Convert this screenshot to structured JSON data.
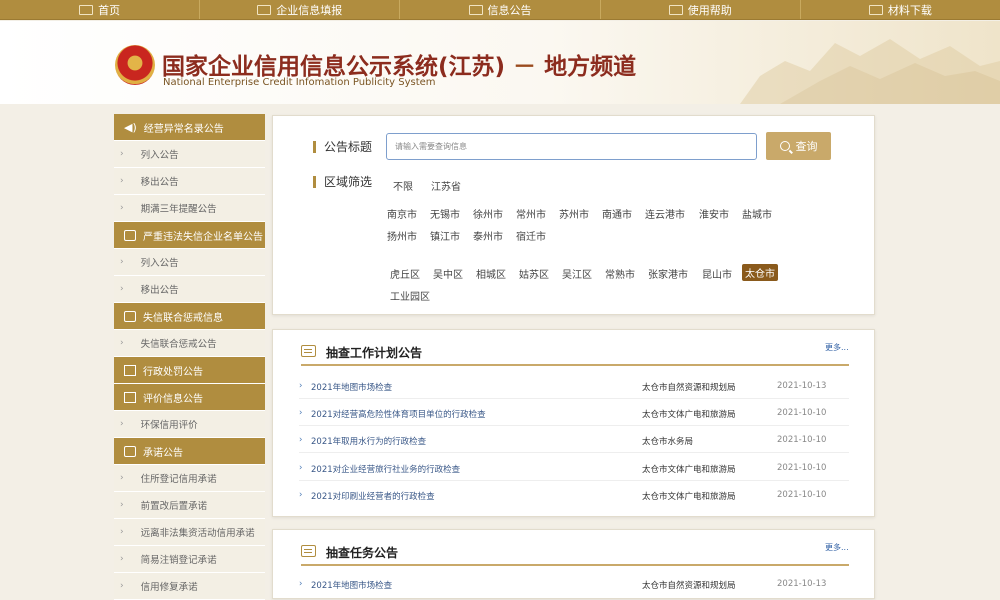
{
  "nav": [
    {
      "label": "首页",
      "icon": "monitor-icon"
    },
    {
      "label": "企业信息填报",
      "icon": "pen-icon"
    },
    {
      "label": "信息公告",
      "icon": "document-icon"
    },
    {
      "label": "使用帮助",
      "icon": "speaker-icon"
    },
    {
      "label": "材料下载",
      "icon": "pen-icon"
    }
  ],
  "header": {
    "title_cn": "国家企业信用信息公示系统(江苏)",
    "title_sep": "－",
    "title_sub": "地方频道",
    "title_en": "National Enterprise Credit Infomation Publicity System"
  },
  "sidebar": {
    "g0": {
      "title": "经营异常名录公告",
      "icon": "speaker-icon",
      "items": [
        "列入公告",
        "移出公告",
        "期满三年提醒公告"
      ]
    },
    "g1": {
      "title": "严重违法失信企业名单公告",
      "icon": "calendar-icon",
      "items": [
        "列入公告",
        "移出公告"
      ]
    },
    "g2": {
      "title": "失信联合惩戒信息",
      "icon": "calendar-icon",
      "items": [
        "失信联合惩戒公告"
      ]
    },
    "g3": {
      "title": "行政处罚公告",
      "icon": "document-icon",
      "items": []
    },
    "g4": {
      "title": "评价信息公告",
      "icon": "document-icon",
      "items": [
        "环保信用评价"
      ]
    },
    "g5": {
      "title": "承诺公告",
      "icon": "calendar-icon",
      "items": [
        "住所登记信用承诺",
        "前置改后置承诺",
        "远离非法集资活动信用承诺",
        "简易注销登记承诺",
        "信用修复承诺"
      ]
    }
  },
  "search": {
    "label": "公告标题",
    "placeholder": "请输入需要查询信息",
    "button": "查询"
  },
  "region": {
    "label": "区域筛选",
    "top": [
      "不限",
      "江苏省"
    ],
    "cities": [
      "南京市",
      "无锡市",
      "徐州市",
      "常州市",
      "苏州市",
      "南通市",
      "连云港市",
      "淮安市",
      "盐城市",
      "扬州市",
      "镇江市",
      "泰州市",
      "宿迁市"
    ],
    "districts": [
      "虎丘区",
      "吴中区",
      "相城区",
      "姑苏区",
      "吴江区",
      "常熟市",
      "张家港市",
      "昆山市",
      "太仓市",
      "工业园区"
    ],
    "selected": "太仓市"
  },
  "plan": {
    "title": "抽查工作计划公告",
    "more": "更多...",
    "rows": [
      {
        "title": "2021年地图市场检查",
        "org": "太仓市自然资源和规划局",
        "date": "2021-10-13"
      },
      {
        "title": "2021对经营高危险性体育项目单位的行政检查",
        "org": "太仓市文体广电和旅游局",
        "date": "2021-10-10"
      },
      {
        "title": "2021年取用水行为的行政检查",
        "org": "太仓市水务局",
        "date": "2021-10-10"
      },
      {
        "title": "2021对企业经营旅行社业务的行政检查",
        "org": "太仓市文体广电和旅游局",
        "date": "2021-10-10"
      },
      {
        "title": "2021对印刷业经营者的行政检查",
        "org": "太仓市文体广电和旅游局",
        "date": "2021-10-10"
      }
    ]
  },
  "task": {
    "title": "抽查任务公告",
    "more": "更多...",
    "rows": [
      {
        "title": "2021年地图市场检查",
        "org": "太仓市自然资源和规划局",
        "date": "2021-10-13"
      }
    ]
  }
}
